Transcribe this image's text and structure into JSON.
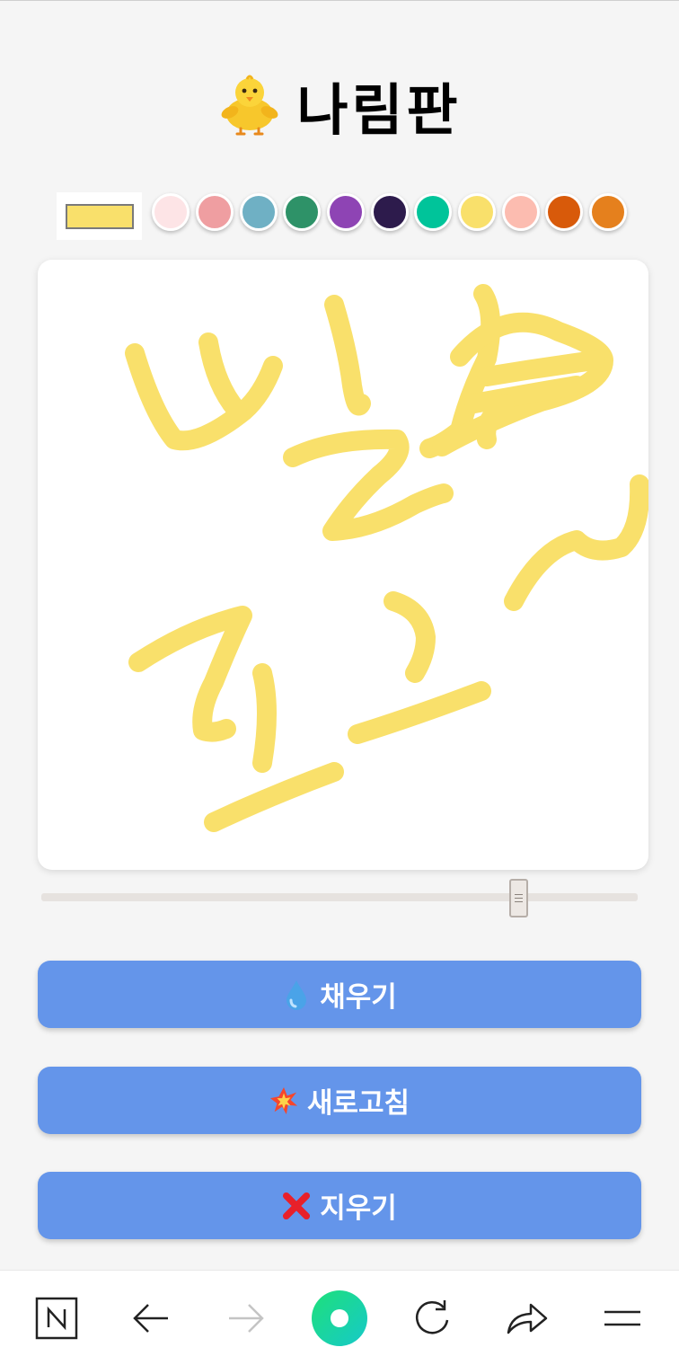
{
  "header": {
    "title": "나림판",
    "icon": "chick-emoji-icon"
  },
  "palette": {
    "current_color": "#f9e06b",
    "colors": [
      "#fde4e6",
      "#ef9ea1",
      "#6fb0c4",
      "#2e9268",
      "#8e44b4",
      "#2d1b4c",
      "#00c49a",
      "#f9e06b",
      "#fcbcb0",
      "#d85a0a",
      "#e5801d"
    ]
  },
  "canvas": {
    "stroke_color": "#f9e06b",
    "background": "#ffffff"
  },
  "brush_size": {
    "value": 0.8
  },
  "buttons": [
    {
      "label": "채우기",
      "icon": "droplet-icon"
    },
    {
      "label": "새로고침",
      "icon": "collision-icon"
    },
    {
      "label": "지우기",
      "icon": "cross-mark-icon"
    }
  ],
  "browser_nav": {
    "items": [
      "naver-home-icon",
      "back-arrow-icon",
      "forward-arrow-icon",
      "green-dot-icon",
      "refresh-icon",
      "share-icon",
      "menu-icon"
    ]
  },
  "colors": {
    "button": "#6495ea",
    "page_bg": "#f5f5f5"
  }
}
